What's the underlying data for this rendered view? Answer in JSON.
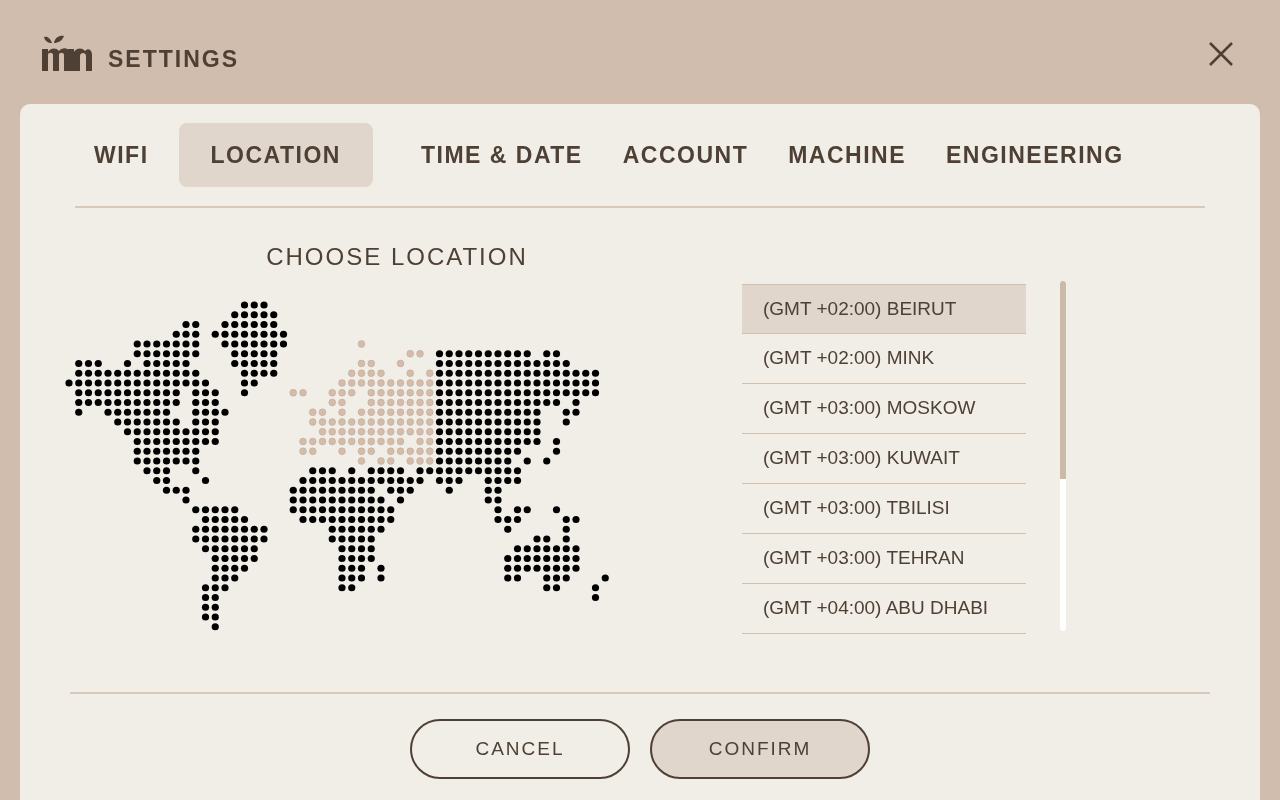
{
  "header": {
    "title": "SETTINGS"
  },
  "tabs": [
    {
      "label": "WIFI",
      "selected": false
    },
    {
      "label": "LOCATION",
      "selected": true
    },
    {
      "label": "TIME & DATE",
      "selected": false
    },
    {
      "label": "ACCOUNT",
      "selected": false
    },
    {
      "label": "MACHINE",
      "selected": false
    },
    {
      "label": "ENGINEERING",
      "selected": false
    }
  ],
  "location": {
    "heading": "CHOOSE LOCATION",
    "timezones": [
      {
        "label": "(GMT +02:00) BEIRUT",
        "selected": true
      },
      {
        "label": "(GMT +02:00) MINK",
        "selected": false
      },
      {
        "label": "(GMT +03:00) MOSKOW",
        "selected": false
      },
      {
        "label": "(GMT +03:00) KUWAIT",
        "selected": false
      },
      {
        "label": "(GMT +03:00) TBILISI",
        "selected": false
      },
      {
        "label": "(GMT +03:00) TEHRAN",
        "selected": false
      },
      {
        "label": "(GMT +04:00) ABU DHABI",
        "selected": false
      }
    ]
  },
  "buttons": [
    {
      "label": "CANCEL",
      "kind": "secondary"
    },
    {
      "label": "CONFIRM",
      "kind": "primary"
    }
  ]
}
